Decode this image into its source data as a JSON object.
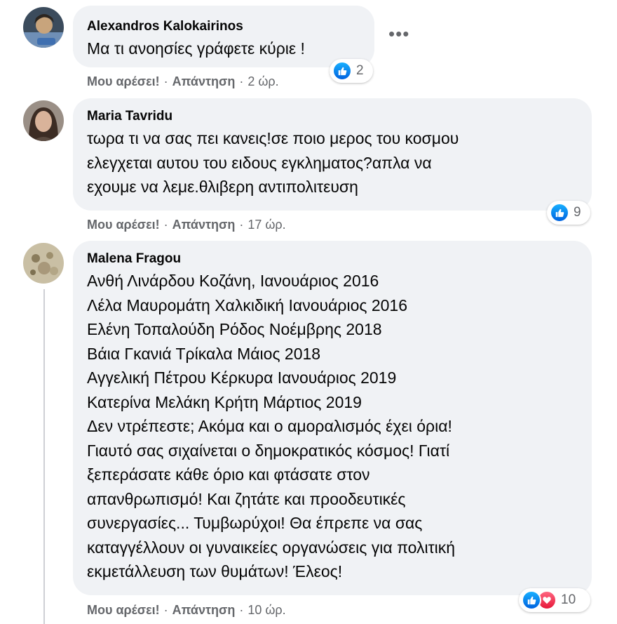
{
  "comments": [
    {
      "author": "Alexandros Kalokairinos",
      "text_lines": [
        "Μα τι ανοησίες γράφετε κύριε !"
      ],
      "like_label": "Μου αρέσει!",
      "reply_label": "Απάντηση",
      "time": "2 ώρ.",
      "reactions": [
        "like-icon"
      ],
      "reaction_count": "2",
      "more_label": "•••"
    },
    {
      "author": "Maria Tavridu",
      "text_lines": [
        "τωρα τι να σας πει κανεις!σε ποιο μερος του κοσμου",
        "ελεγχεται αυτου του ειδους εγκληματος?απλα να",
        "εχουμε να λεμε.θλιβερη αντιπολιτευση"
      ],
      "like_label": "Μου αρέσει!",
      "reply_label": "Απάντηση",
      "time": "17 ώρ.",
      "reactions": [
        "like-icon"
      ],
      "reaction_count": "9"
    },
    {
      "author": "Malena Fragou",
      "text_lines": [
        "Ανθή Λινάρδου Κοζάνη, Ιανουάριος 2016",
        "Λέλα Μαυρομάτη Χαλκιδική Ιανουάριος 2016",
        "Ελένη Τοπαλούδη Ρόδος Νοέμβρης 2018",
        "Βάια Γκανιά Τρίκαλα Μάιος 2018",
        "Αγγελική Πέτρου Κέρκυρα Ιανουάριος 2019",
        "Κατερίνα Μελάκη Κρήτη Μάρτιος 2019",
        "Δεν ντρέπεστε; Ακόμα και ο αμοραλισμός έχει όρια!",
        "Γιαυτό σας σιχαίνεται ο δημοκρατικός κόσμος! Γιατί",
        "ξεπεράσατε κάθε όριο και φτάσατε στον",
        "απανθρωπισμό! Και ζητάτε και προοδευτικές",
        "συνεργασίες... Τυμβωρύχοι! Θα έπρεπε να σας",
        "καταγγέλλουν οι γυναικείες οργανώσεις για πολιτική",
        "εκμετάλλευση των θυμάτων! Έλεος!"
      ],
      "like_label": "Μου αρέσει!",
      "reply_label": "Απάντηση",
      "time": "10 ώρ.",
      "reactions": [
        "like-icon",
        "love-icon"
      ],
      "reaction_count": "10"
    }
  ],
  "colors": {
    "bubble": "#f0f2f5",
    "like_blue": "#1877f2",
    "love_red": "#f33e58",
    "meta_gray": "#65676b"
  }
}
